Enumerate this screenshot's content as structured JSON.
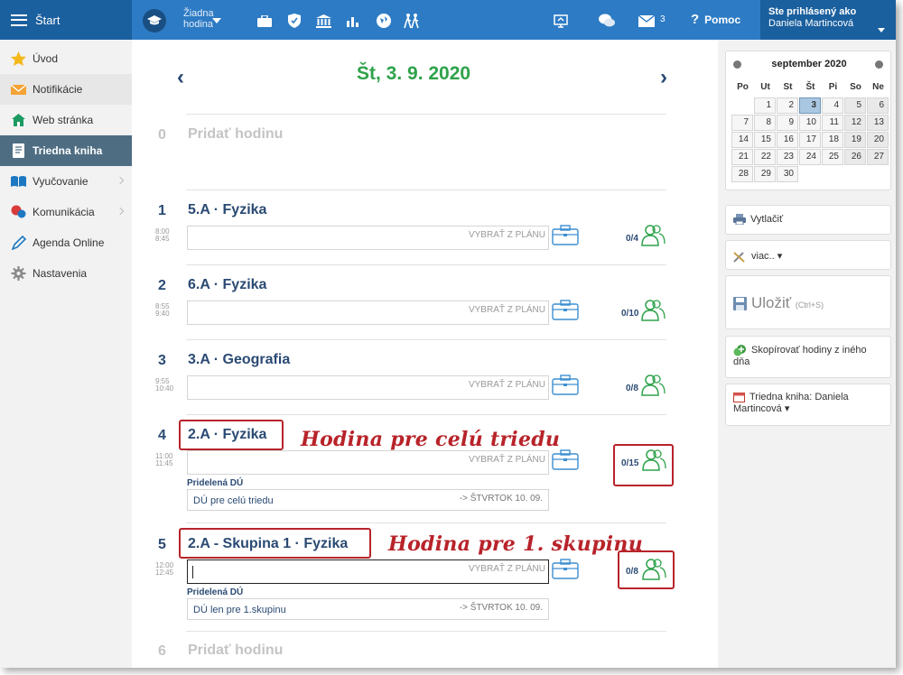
{
  "topbar": {
    "start_label": "Štart",
    "lesson_selector": {
      "line1": "Žiadna",
      "line2": "hodina"
    },
    "mail_count": "3",
    "help_label": "Pomoc",
    "user": {
      "line1": "Ste prihlásený ako",
      "line2": "Daniela Martincová"
    },
    "accent": "#2d7bc4"
  },
  "sidebar": {
    "items": [
      {
        "label": "Úvod",
        "icon": "star-icon"
      },
      {
        "label": "Notifikácie",
        "icon": "envelope-icon"
      },
      {
        "label": "Web stránka",
        "icon": "home-icon"
      },
      {
        "label": "Triedna kniha",
        "icon": "book-icon"
      },
      {
        "label": "Vyučovanie",
        "icon": "open-book-icon"
      },
      {
        "label": "Komunikácia",
        "icon": "chat-icon"
      },
      {
        "label": "Agenda Online",
        "icon": "pen-icon"
      },
      {
        "label": "Nastavenia",
        "icon": "gear-icon"
      }
    ]
  },
  "main": {
    "date": "Št, 3. 9. 2020",
    "prev": "‹",
    "next": "›",
    "lessons": [
      {
        "num": "0",
        "title": "Pridať hodinu"
      },
      {
        "num": "1",
        "title": "5.A · Fyzika",
        "start": "8:00",
        "end": "8:45",
        "placeholder": "VYBRAŤ Z PLÁNU",
        "count": "0/4"
      },
      {
        "num": "2",
        "title": "6.A · Fyzika",
        "start": "8:55",
        "end": "9:40",
        "placeholder": "VYBRAŤ Z PLÁNU",
        "count": "0/10"
      },
      {
        "num": "3",
        "title": "3.A · Geografia",
        "start": "9:55",
        "end": "10:40",
        "placeholder": "VYBRAŤ Z PLÁNU",
        "count": "0/8"
      },
      {
        "num": "4",
        "title": "2.A · Fyzika",
        "start": "11:00",
        "end": "11:45",
        "placeholder": "VYBRAŤ Z PLÁNU",
        "count": "0/15",
        "hw_label": "Pridelená DÚ",
        "hw_text": "DÚ pre celú triedu",
        "hw_due": "-> ŠTVRTOK 10. 09."
      },
      {
        "num": "5",
        "title": "2.A - Skupina 1 · Fyzika",
        "start": "12:00",
        "end": "12:45",
        "placeholder": "VYBRAŤ Z PLÁNU",
        "count": "0/8",
        "hw_label": "Pridelená DÚ",
        "hw_text": "DÚ len pre 1.skupinu",
        "hw_due": "-> ŠTVRTOK 10. 09."
      },
      {
        "num": "6",
        "title": "Pridať hodinu"
      }
    ],
    "annotations": {
      "whole_class": "Hodina pre celú triedu",
      "group": "Hodina pre 1. skupinu"
    }
  },
  "calendar": {
    "month": "september 2020",
    "dow": [
      "Po",
      "Ut",
      "St",
      "Št",
      "Pi",
      "So",
      "Ne"
    ],
    "first_offset": 1,
    "days_in_month": 30,
    "today": 3
  },
  "right": {
    "print": "Vytlačiť",
    "more": "viac.. ▾",
    "save": "Uložiť",
    "save_hint": "(Ctrl+S)",
    "copy": "Skopírovať hodiny z iného dňa",
    "book": "Triedna kniha: Daniela Martincová ▾"
  }
}
